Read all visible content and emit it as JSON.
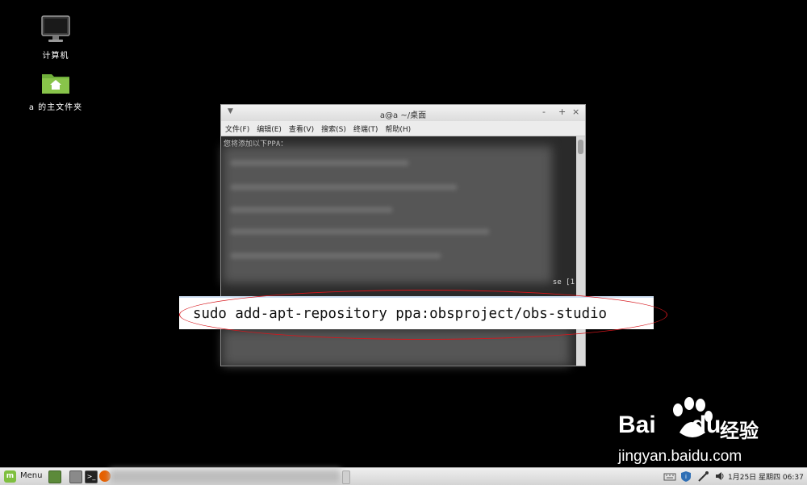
{
  "desktop": {
    "icons": [
      {
        "label": "计算机",
        "icon": "monitor-icon"
      },
      {
        "label": "a 的主文件夹",
        "icon": "home-folder-icon"
      }
    ]
  },
  "terminal": {
    "title": "a@a ~/桌面",
    "menus": [
      "文件(F)",
      "编辑(E)",
      "查看(V)",
      "搜索(S)",
      "终端(T)",
      "帮助(H)"
    ],
    "first_line": "您将添加以下PPA：",
    "partial_text": "se [1",
    "window_controls": [
      "-",
      "+",
      "×"
    ]
  },
  "highlight": {
    "command": "sudo add-apt-repository ppa:obsproject/obs-studio"
  },
  "watermark": {
    "brand_a": "Bai",
    "brand_b": "du",
    "brand_cn": "经验",
    "url": "jingyan.baidu.com"
  },
  "taskbar": {
    "menu_label": "Menu",
    "clock": "1月25日 星期四 06:37",
    "colors": {
      "mint": "#7fbf3f",
      "firefox": "#e66000"
    }
  }
}
